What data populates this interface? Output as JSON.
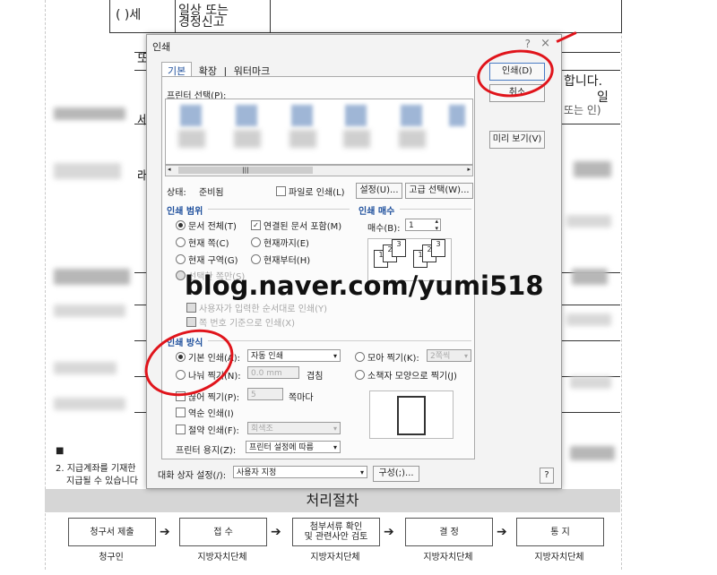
{
  "document": {
    "top_cell_paren": "(      )세",
    "top_cell_label": "일상 또는\n경정신고",
    "right_text_1": "합니다.",
    "right_text_2": "일",
    "right_text_3": "또는 인)",
    "left_frag_1": "또",
    "left_frag_2": "세",
    "left_frag_3": "래",
    "bottom_note_1": "2. 지급계좌를 기재한",
    "bottom_note_2": "지급될 수 있습니다",
    "process_title": "처리절차",
    "process_steps": [
      {
        "box": "청구서 제출",
        "label": "청구인"
      },
      {
        "box": "접  수",
        "label": "지방자치단체"
      },
      {
        "box": "첨부서류 확인\n및 관련사안 검토",
        "label": "지방자치단체"
      },
      {
        "box": "결  정",
        "label": "지방자치단체"
      },
      {
        "box": "통  지",
        "label": "지방자치단체"
      }
    ],
    "arrow": "➔"
  },
  "dialog": {
    "title": "인쇄",
    "help": "?",
    "close": "×",
    "tabs": [
      "기본",
      "확장",
      "워터마크"
    ],
    "tab_sep": "|",
    "printer_select_label": "프린터 선택(P):",
    "scroll_thumb": "|||",
    "status_label": "상태:",
    "status_value": "준비됨",
    "print_to_file": "파일로 인쇄(L)",
    "settings_button": "설정(U)...",
    "advanced_button": "고급 선택(W)...",
    "print_button": "인쇄(D)",
    "cancel_button": "취소",
    "preview_button": "미리 보기(V)",
    "range_title": "인쇄 범위",
    "range_all": "문서 전체(T)",
    "range_linked": "연결된 문서 포함(M)",
    "range_current_page": "현재 쪽(C)",
    "range_to_current": "현재까지(E)",
    "range_current_section": "현재 구역(G)",
    "range_from_current": "현재부터(H)",
    "range_selection": "선택한 쪽만(S)",
    "range_custom_order": "사용자가 입력한 순서대로 인쇄(Y)",
    "range_page_number": "쪽 번호 기준으로 인쇄(X)",
    "copies_title": "인쇄 매수",
    "copies_label": "매수(B):",
    "copies_value": "1",
    "collate_labels": [
      "1",
      "2",
      "3",
      "1",
      "2",
      "3"
    ],
    "method_title": "인쇄 방식",
    "method_default": "기본 인쇄(A):",
    "method_default_value": "자동 인쇄",
    "method_split": "나눠 찍기(N):",
    "method_split_value": "0.0",
    "method_split_unit": "mm",
    "method_split_suffix": "겹침",
    "method_multi_page": "모아 찍기(K):",
    "method_multi_value": "2쪽씩",
    "method_booklet": "소책자 모양으로 찍기(J)",
    "method_repeat": "끊어 찍기(P):",
    "method_repeat_value": "5",
    "method_repeat_suffix": "쪽마다",
    "method_reverse": "역순 인쇄(I)",
    "method_save": "절약 인쇄(F):",
    "method_save_value": "회색조",
    "paper_label": "프린터 용지(Z):",
    "paper_value": "프린터 설정에 따름",
    "dialog_setting_label": "대화 상자 설정(/):",
    "dialog_setting_value": "사용자 지정",
    "compose_button": "구성(;)...",
    "help_button": "?"
  },
  "watermark_text": "blog.naver.com/yumi518",
  "accent_red": "#e0141b",
  "accent_blue": "#1e4f9c"
}
